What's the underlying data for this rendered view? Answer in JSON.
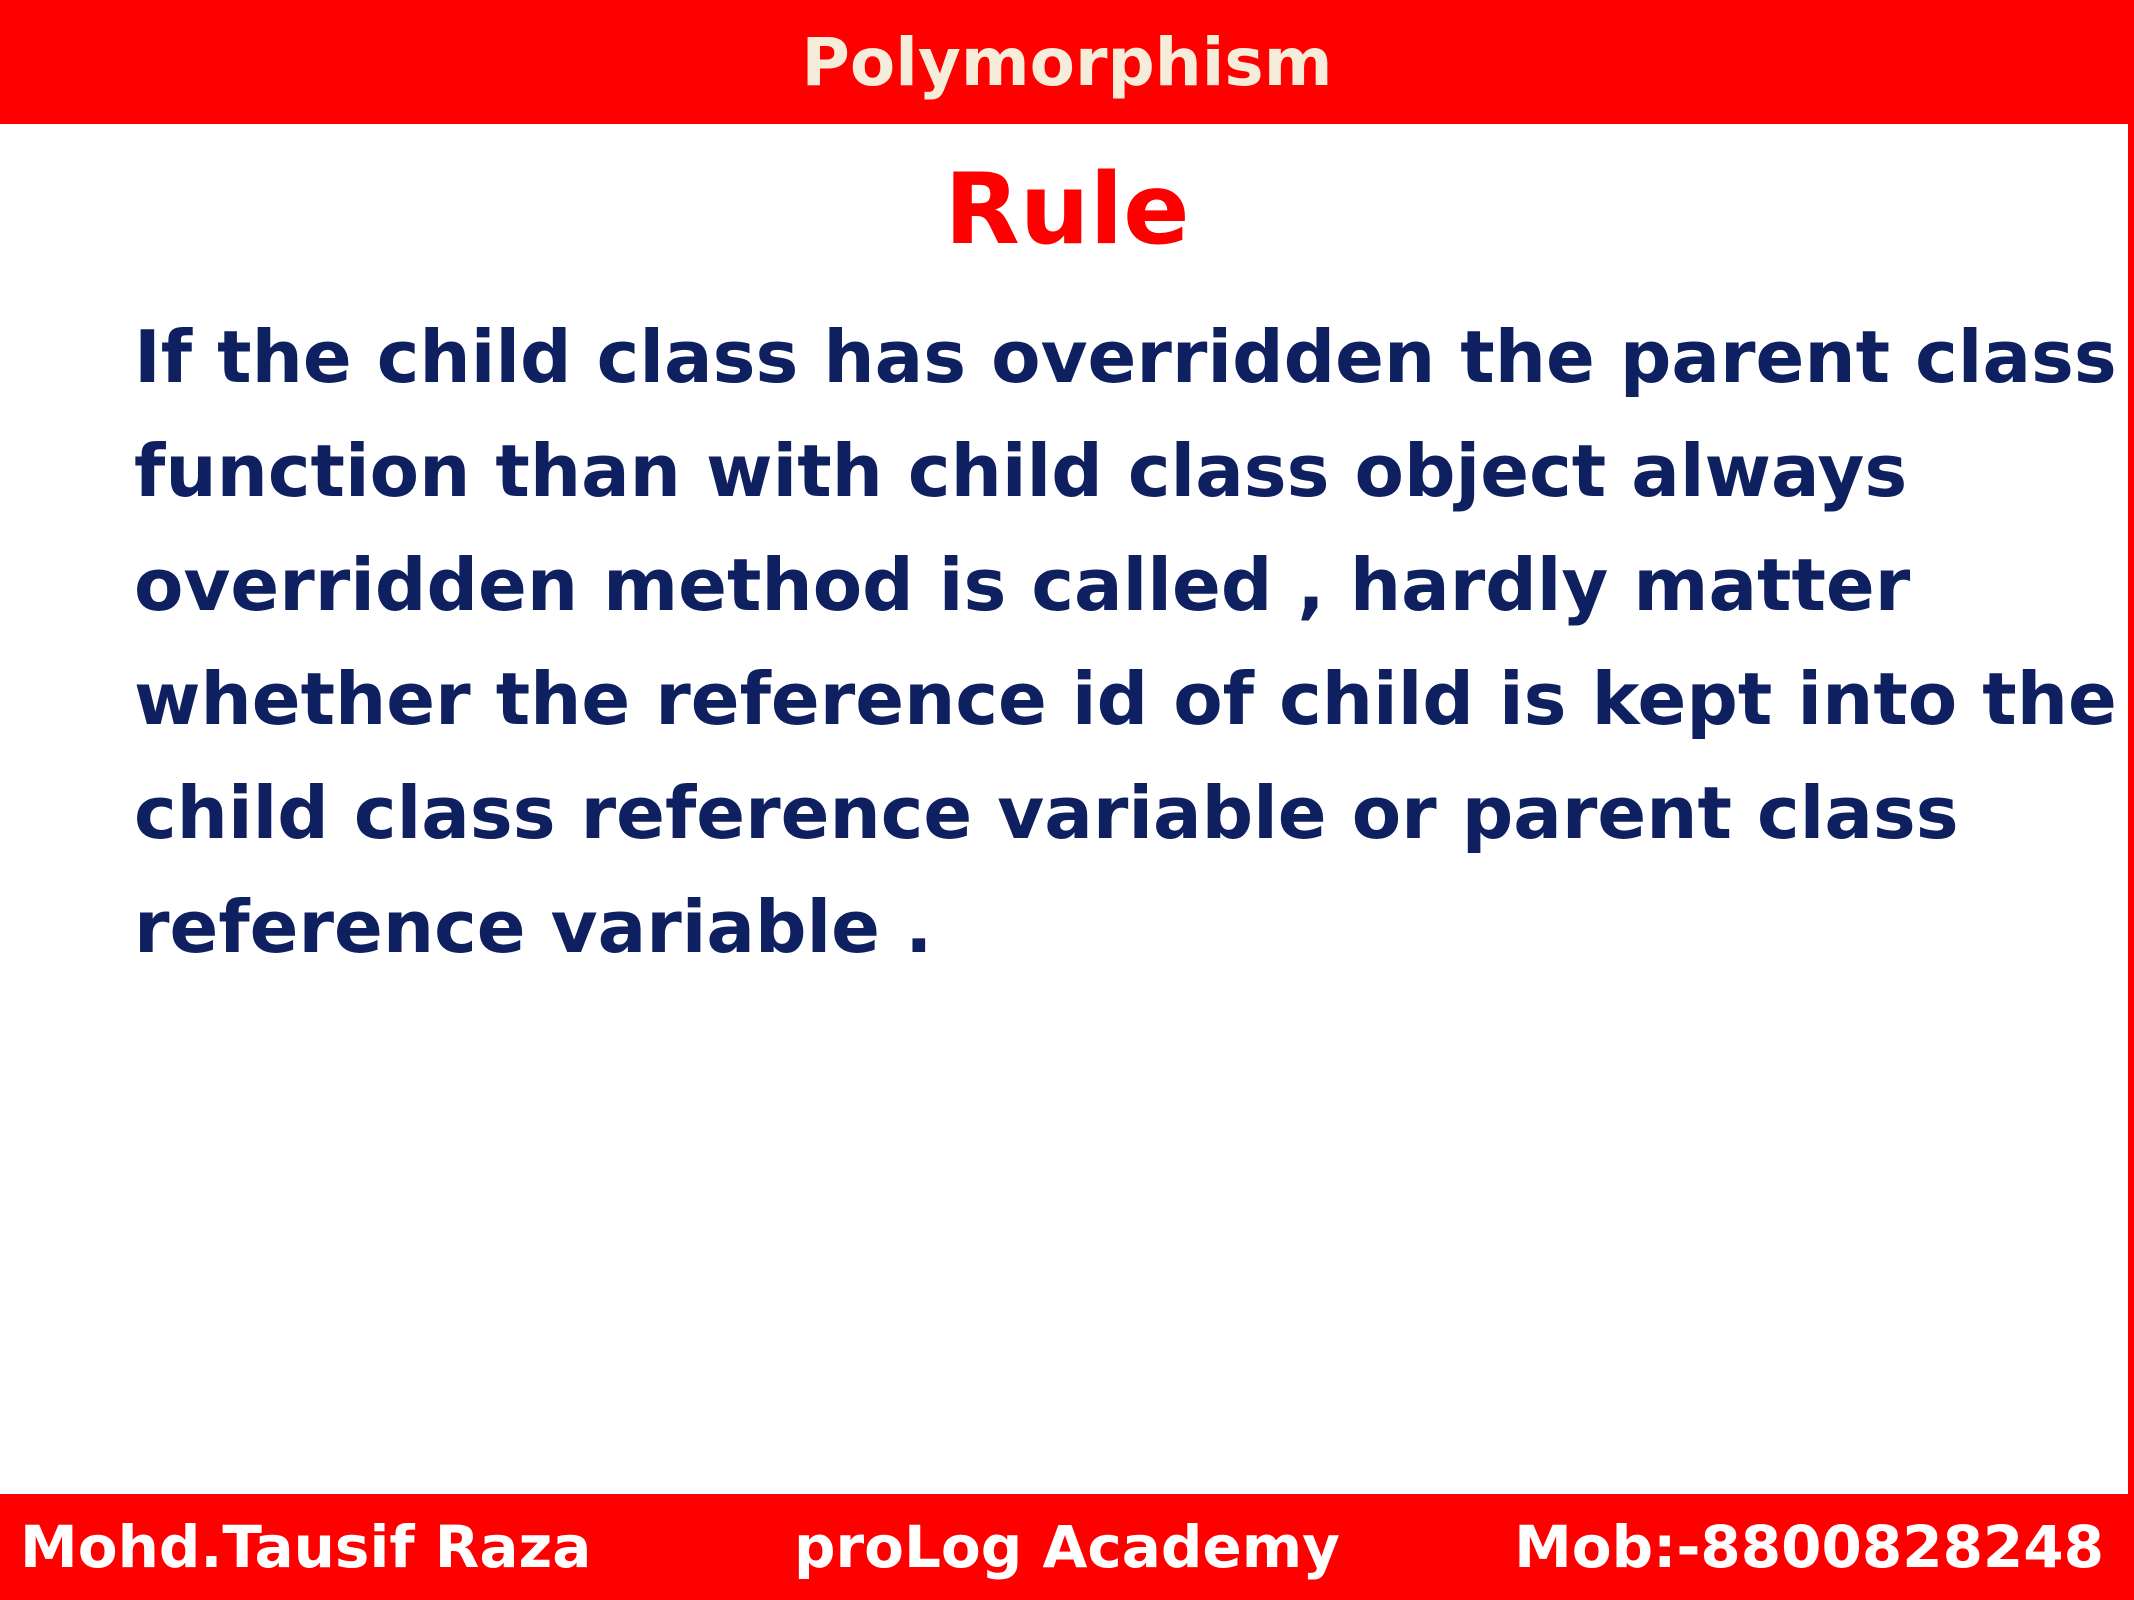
{
  "header": {
    "title": "Polymorphism"
  },
  "slide": {
    "heading": "Rule",
    "body_lines": [
      "If the child class has overridden the parent class",
      "function than with child class object always",
      "overridden method is called , hardly matter",
      "whether the reference id of child is kept into the",
      "child class reference variable or parent class",
      "reference variable ."
    ]
  },
  "footer": {
    "author": "Mohd.Tausif Raza",
    "academy": "proLog Academy",
    "phone": "Mob:-8800828248"
  },
  "colors": {
    "bar": "#ff0000",
    "heading": "#ff0000",
    "body_text": "#0f2060",
    "header_text": "#f5ecd9",
    "footer_text": "#ffffff"
  }
}
